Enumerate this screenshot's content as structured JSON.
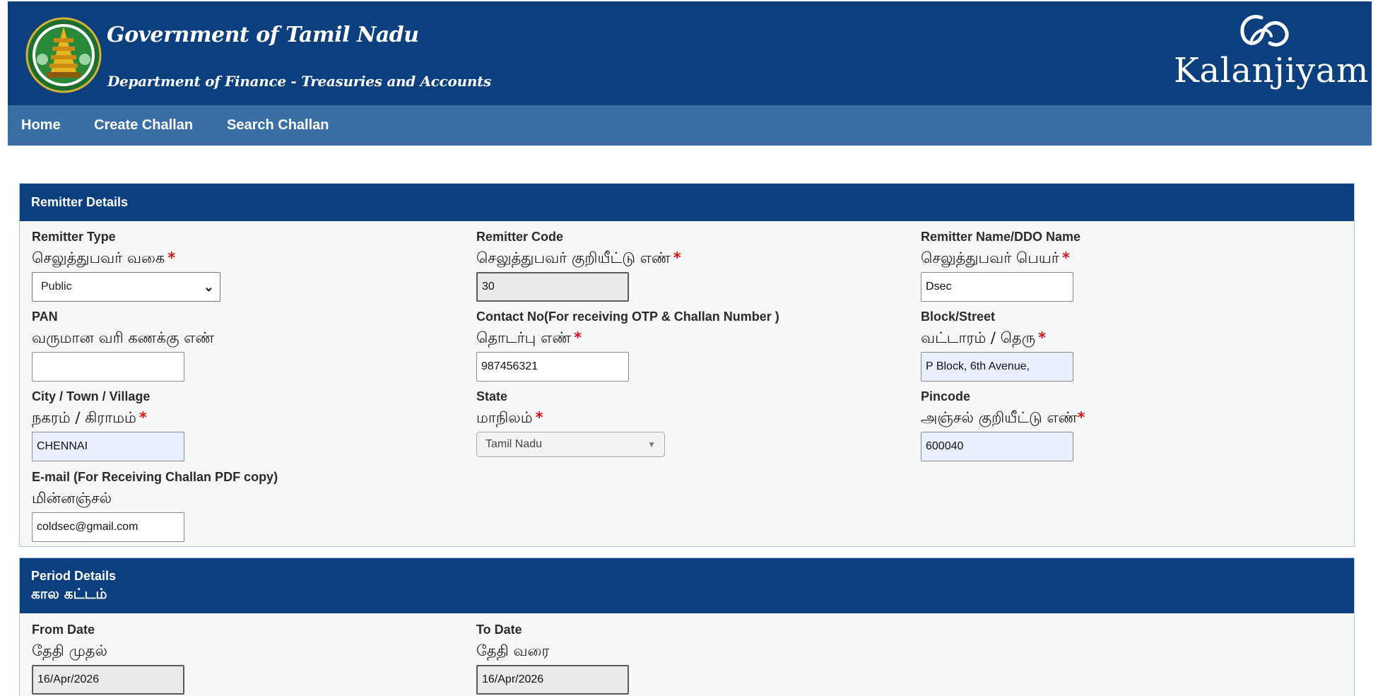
{
  "header": {
    "gov_title": "Government of Tamil Nadu",
    "dept_title": "Department of Finance - Treasuries and Accounts",
    "brand": "Kalanjiyam",
    "emblem_icon": "tamil-nadu-emblem-icon",
    "brand_icon": "kalanjiyam-logo-icon",
    "bg_color": "#0b3f7d"
  },
  "nav": {
    "items": [
      {
        "label": "Home"
      },
      {
        "label": "Create Challan"
      },
      {
        "label": "Search Challan"
      }
    ],
    "bg_color": "#3a6fa6"
  },
  "remitter": {
    "heading": "Remitter Details",
    "fields": {
      "type": {
        "en": "Remitter Type",
        "ta": "செலுத்துபவர் வகை",
        "required": "*",
        "value": "Public"
      },
      "code": {
        "en": "Remitter Code",
        "ta": "செலுத்துபவர் குறியீட்டு எண்",
        "required": "*",
        "value": "30"
      },
      "name": {
        "en": "Remitter Name/DDO Name",
        "ta": "செலுத்துபவர் பெயர்",
        "required": "*",
        "value": "Dsec"
      },
      "pan": {
        "en": "PAN",
        "ta": "வருமான வரி கணக்கு எண்",
        "value": ""
      },
      "contact": {
        "en": "Contact No(For receiving OTP & Challan Number )",
        "ta": "தொடர்பு எண்",
        "required": "*",
        "value": "987456321"
      },
      "block": {
        "en": "Block/Street",
        "ta": "வட்டாரம் / தெரு",
        "required": "*",
        "value": "P Block, 6th Avenue,"
      },
      "city": {
        "en": "City / Town / Village",
        "ta": "நகரம் / கிராமம்",
        "required": "*",
        "value": "CHENNAI"
      },
      "state": {
        "en": "State",
        "ta": "மாநிலம்",
        "required": "*",
        "value": "Tamil Nadu"
      },
      "pincode": {
        "en": "Pincode",
        "ta": "அஞ்சல் குறியீட்டு எண்",
        "required": "*",
        "value": "600040"
      },
      "email": {
        "en": "E-mail (For Receiving Challan PDF copy)",
        "ta": "மின்னஞ்சல்",
        "value": "coldsec@gmail.com"
      }
    }
  },
  "period": {
    "heading": "Period Details",
    "heading_ta": "கால கட்டம்",
    "from": {
      "en": "From Date",
      "ta": "தேதி முதல்",
      "value": "16/Apr/2026"
    },
    "to": {
      "en": "To Date",
      "ta": "தேதி வரை",
      "value": "16/Apr/2026"
    }
  }
}
